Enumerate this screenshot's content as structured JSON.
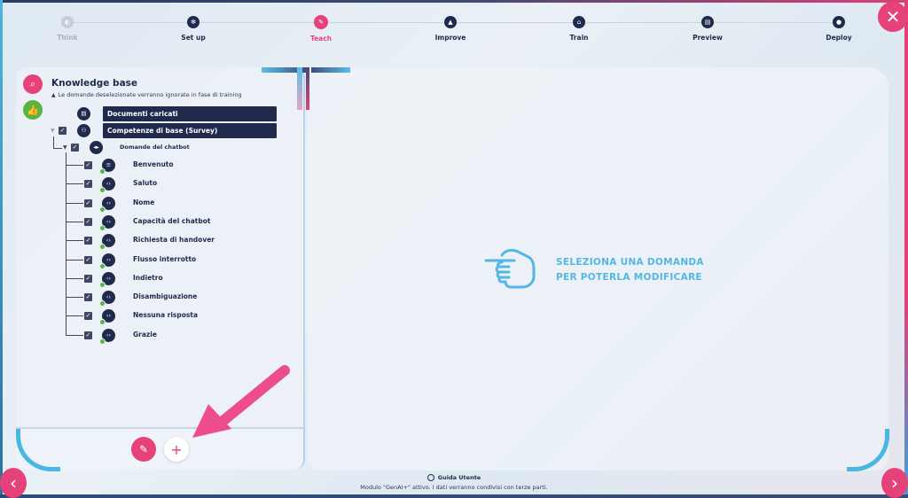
{
  "stepper": {
    "steps": [
      {
        "label": "Think",
        "state": "inactive",
        "icon": "idea-icon"
      },
      {
        "label": "Set up",
        "state": "done",
        "icon": "gear-icon"
      },
      {
        "label": "Teach",
        "state": "active",
        "icon": "pencil-icon"
      },
      {
        "label": "Improve",
        "state": "done",
        "icon": "up-icon"
      },
      {
        "label": "Train",
        "state": "done",
        "icon": "robot-icon"
      },
      {
        "label": "Preview",
        "state": "done",
        "icon": "preview-icon"
      },
      {
        "label": "Deploy",
        "state": "done",
        "icon": "deploy-icon"
      }
    ]
  },
  "knowledge_base": {
    "title": "Knowledge base",
    "note": "Le domande deselezionate verranno ignorate in fase di training",
    "root_nodes": [
      {
        "label": "Documenti caricati",
        "icon": "document-icon"
      },
      {
        "label": "Competenze di base (Survey)",
        "icon": "network-icon"
      }
    ],
    "group": {
      "label": "Domande del chatbot",
      "icon": "chatbot-icon"
    },
    "items": [
      {
        "label": "Benvenuto",
        "icon": "text-icon"
      },
      {
        "label": "Saluto",
        "icon": "code-icon"
      },
      {
        "label": "Nome",
        "icon": "code-icon"
      },
      {
        "label": "Capacità del chatbot",
        "icon": "code-icon"
      },
      {
        "label": "Richiesta di handover",
        "icon": "code-icon"
      },
      {
        "label": "Flusso interrotto",
        "icon": "code-icon"
      },
      {
        "label": "Indietro",
        "icon": "code-icon"
      },
      {
        "label": "Disambiguazione",
        "icon": "code-icon"
      },
      {
        "label": "Nessuna risposta",
        "icon": "code-icon"
      },
      {
        "label": "Grazie",
        "icon": "code-icon"
      }
    ]
  },
  "editor": {
    "prompt_line1": "SELEZIONA UNA DOMANDA",
    "prompt_line2": "PER POTERLA MODIFICARE"
  },
  "footer": {
    "guide_label": "Guida Utente",
    "note": "Modulo \"GenAI+\" attivo. I dati verranno condivisi con terze parti."
  },
  "colors": {
    "accent": "#e5427a",
    "navy": "#1f2a4d",
    "cyan": "#55b6e3",
    "green": "#5ab443"
  }
}
